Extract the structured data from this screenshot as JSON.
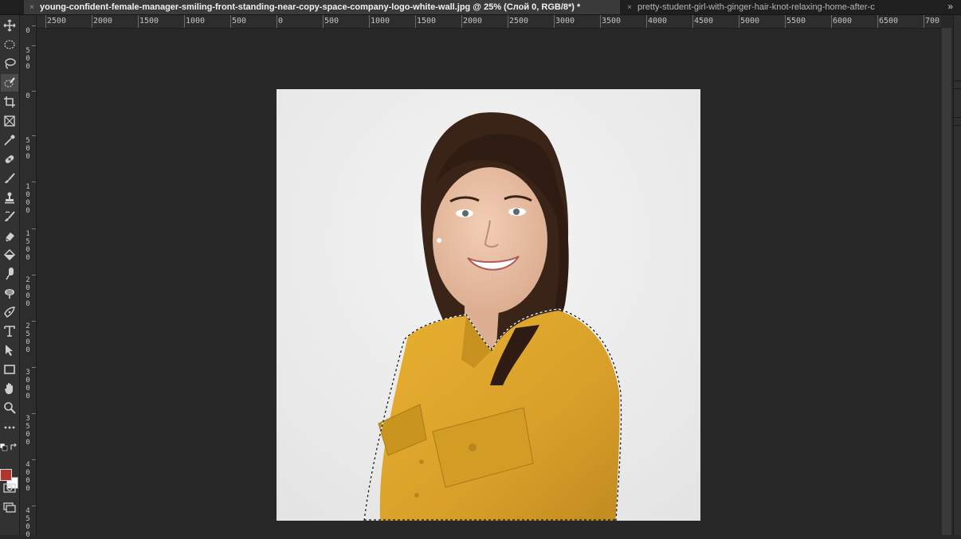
{
  "tabs": [
    {
      "label": "young-confident-female-manager-smiling-front-standing-near-copy-space-company-logo-white-wall.jpg @ 25% (Слой 0, RGB/8*) *",
      "close": "×"
    },
    {
      "label": "pretty-student-girl-with-ginger-hair-knot-relaxing-home-after-c",
      "close": "×"
    }
  ],
  "tab_overflow": "»",
  "hruler_labels": [
    "2500",
    "2000",
    "1500",
    "1000",
    "500",
    "0",
    "500",
    "1000",
    "1500",
    "2000",
    "2500",
    "3000",
    "3500",
    "4000",
    "4500",
    "5000",
    "5500",
    "6000",
    "6500",
    "700"
  ],
  "vruler_labels": [
    "0",
    "5\n0\n0",
    "0",
    "5\n0\n0",
    "1\n0\n0\n0",
    "1\n5\n0\n0",
    "2\n0\n0\n0",
    "2\n5\n0\n0",
    "3\n0\n0\n0",
    "3\n5\n0\n0",
    "4\n0\n0\n0",
    "4\n5\n0\n0"
  ],
  "colors": {
    "foreground": "#b0352c",
    "background": "#ffffff"
  },
  "tools": [
    "move-icon",
    "marquee-icon",
    "lasso-icon",
    "quick-selection-icon",
    "crop-icon",
    "frame-icon",
    "eyedropper-icon",
    "healing-brush-icon",
    "brush-icon",
    "clone-stamp-icon",
    "history-brush-icon",
    "eraser-icon",
    "paint-bucket-icon",
    "smudge-icon",
    "dodge-icon",
    "pen-icon",
    "type-icon",
    "path-selection-icon",
    "rectangle-icon",
    "hand-icon",
    "zoom-icon",
    "more-tools-icon"
  ]
}
